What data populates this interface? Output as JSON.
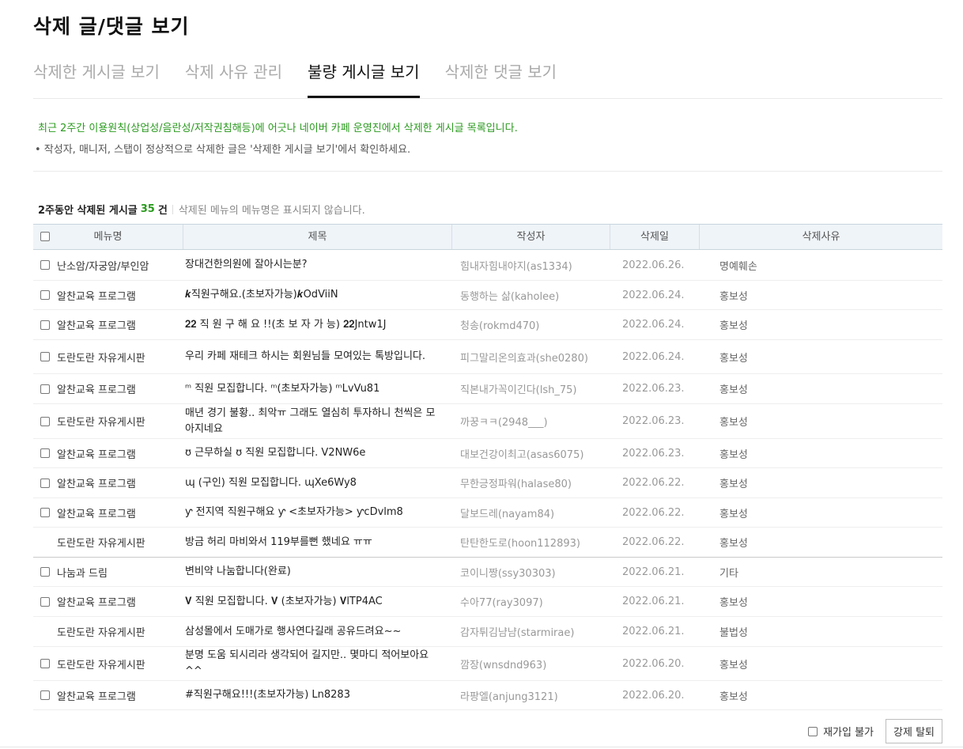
{
  "page_title": "삭제 글/댓글 보기",
  "tabs": [
    {
      "label": "삭제한 게시글 보기"
    },
    {
      "label": "삭제 사유 관리"
    },
    {
      "label": "불량 게시글 보기"
    },
    {
      "label": "삭제한 댓글 보기"
    }
  ],
  "notice": {
    "green": "최근 2주간 이용원칙(상업성/음란성/저작권침해등)에 어긋나 네이버 카페 운영진에서 삭제한 게시글 목록입니다.",
    "gray": "• 작성자, 매니저, 스탭이 정상적으로 삭제한 글은 '삭제한 게시글 보기'에서 확인하세요."
  },
  "summary": {
    "prefix": "2주동안 삭제된 게시글",
    "count": "35",
    "suffix": "건",
    "desc": "삭제된 메뉴의 메뉴명은 표시되지 않습니다."
  },
  "table": {
    "headers": {
      "menu": "메뉴명",
      "title": "제목",
      "author": "작성자",
      "date": "삭제일",
      "reason": "삭제사유"
    },
    "rows": [
      {
        "menu": "난소암/자궁암/부인암",
        "title": "장대건한의원에 잘아시는분?",
        "author": "힘내자힘내야지(as1334)",
        "date": "2022.06.26.",
        "reason": "명예훼손"
      },
      {
        "menu": "알찬교육 프로그램",
        "title": "𝒌직원구해요.(초보자가능)𝒌OdViiN",
        "author": "동행하는 삶(kaholee)",
        "date": "2022.06.24.",
        "reason": "홍보성"
      },
      {
        "menu": "알찬교육 프로그램",
        "title": "𝟐𝟐 직 원 구 해 요 !!(초 보 자 가 능) 𝟐𝟐Jntw1J",
        "author": "청송(rokmd470)",
        "date": "2022.06.24.",
        "reason": "홍보성"
      },
      {
        "menu": "도란도란 자유게시판",
        "title": "우리 카페 재테크 하시는 회원님들 모여있는 톡방입니다.",
        "author": "피그말리온의효과(she0280)",
        "date": "2022.06.24.",
        "reason": "홍보성"
      },
      {
        "menu": "알찬교육 프로그램",
        "title": "ᵐ 직원 모집합니다. ᵐ(초보자가능) ᵐLvVu81",
        "author": "직본내가꼭이긴다(lsh_75)",
        "date": "2022.06.23.",
        "reason": "홍보성"
      },
      {
        "menu": "도란도란 자유게시판",
        "title": "매년 경기 불황.. 최악ㅠ 그래도 열심히 투자하니 천씩은 모아지네요",
        "author": "까꿍ㅋㅋ(2948___)",
        "date": "2022.06.23.",
        "reason": "홍보성"
      },
      {
        "menu": "알찬교육 프로그램",
        "title": "ʊ 근무하실 ʊ 직원 모집합니다. V2NW6e",
        "author": "대보건강이최고(asas6075)",
        "date": "2022.06.23.",
        "reason": "홍보성"
      },
      {
        "menu": "알찬교육 프로그램",
        "title": "ɰ (구인) 직원 모집합니다. ɰXe6Wy8",
        "author": "무한긍정파워(halase80)",
        "date": "2022.06.22.",
        "reason": "홍보성"
      },
      {
        "menu": "알찬교육 프로그램",
        "title": "ƴ 전지역 직원구해요 ƴ <초보자가능> ƴcDvlm8",
        "author": "달보드레(nayam84)",
        "date": "2022.06.22.",
        "reason": "홍보성"
      },
      {
        "menu": "도란도란 자유게시판",
        "title": "방금 허리 마비와서 119부를뻔 했네요 ㅠㅠ",
        "author": "탄탄한도로(hoon112893)",
        "date": "2022.06.22.",
        "reason": "홍보성"
      },
      {
        "menu": "나눔과 드림",
        "title": "변비약 나눔합니다(완료)",
        "author": "코이니짱(ssy30303)",
        "date": "2022.06.21.",
        "reason": "기타"
      },
      {
        "menu": "알찬교육 프로그램",
        "title": "𝐕 직원 모집합니다. 𝐕 (초보자가능) 𝐕lTP4AC",
        "author": "수아77(ray3097)",
        "date": "2022.06.21.",
        "reason": "홍보성"
      },
      {
        "menu": "도란도란 자유게시판",
        "title": "삼성몰에서 도매가로 행사연다길래 공유드려요~~",
        "author": "감자튀김냠냠(starmirae)",
        "date": "2022.06.21.",
        "reason": "불법성"
      },
      {
        "menu": "도란도란 자유게시판",
        "title": "분명 도움 되시리라 생각되어 길지만.. 몇마디 적어보아요^^",
        "author": "깜장(wnsdnd963)",
        "date": "2022.06.20.",
        "reason": "홍보성"
      },
      {
        "menu": "알찬교육 프로그램",
        "title": "#직원구해요!!!(초보자가능) Ln8283",
        "author": "라팡엘(anjung3121)",
        "date": "2022.06.20.",
        "reason": "홍보성"
      }
    ]
  },
  "footer": {
    "rejoin_label": "재가입 불가",
    "kick_button": "강제 탈퇴"
  }
}
